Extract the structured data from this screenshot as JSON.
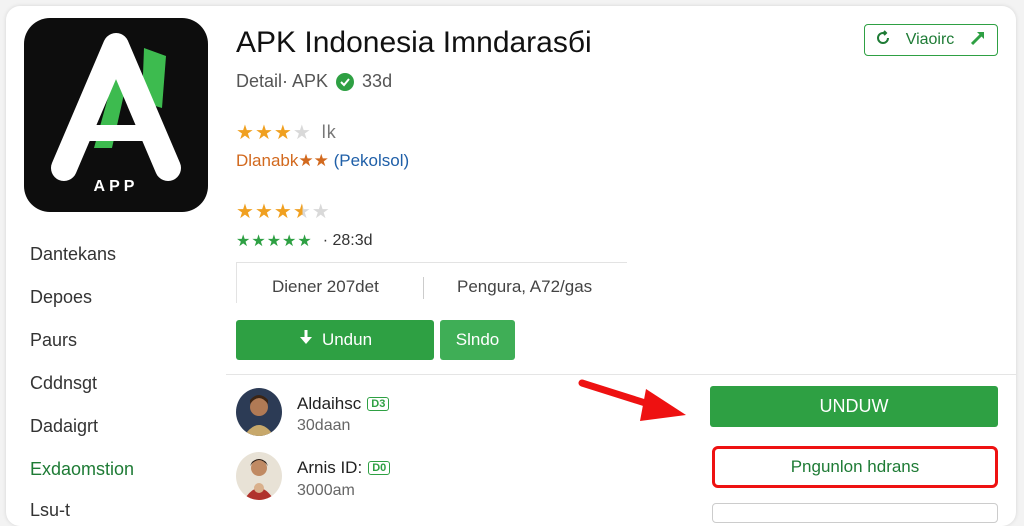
{
  "app": {
    "icon_caption": "APP",
    "title": "APK Indonesia Imndarasбi",
    "subtitle": "Detail· APK",
    "version": "33d",
    "top_button_label": "Viaoirc"
  },
  "ratings": {
    "row1": {
      "stars": 3,
      "max": 5,
      "count": "lk"
    },
    "row2": {
      "left_text": "Dlanabk★★",
      "right_text": "(Pekolsol)"
    },
    "row3": {
      "stars": 3.5,
      "max": 5
    },
    "row4": {
      "stars_text": "★★★★★",
      "detail": "· 28:3d"
    }
  },
  "info": {
    "left": "Diener 207det",
    "right": "Pengura, A72/gas"
  },
  "buttons": {
    "download": "Undun",
    "secondary": "Slndo",
    "big_download": "UNDUW",
    "outlined": "Pngunlon hdrans"
  },
  "sidebar": {
    "items": [
      {
        "label": "Dantekans",
        "active": false
      },
      {
        "label": "Depoes",
        "active": false
      },
      {
        "label": "Paurs",
        "active": false
      },
      {
        "label": "Cddnsgt",
        "active": false
      },
      {
        "label": "Dadaigrt",
        "active": false
      },
      {
        "label": "Exdaomstion",
        "active": true
      },
      {
        "label": "Lsu-t",
        "active": false
      }
    ]
  },
  "users": [
    {
      "name": "Aldaihsc",
      "tag": "D3",
      "time": "30daan"
    },
    {
      "name": "Arnis ID:",
      "tag": "D0",
      "time": "3000am"
    }
  ],
  "colors": {
    "accent_green": "#2ea043",
    "annotation_red": "#e11111",
    "star_orange": "#f0a020"
  }
}
